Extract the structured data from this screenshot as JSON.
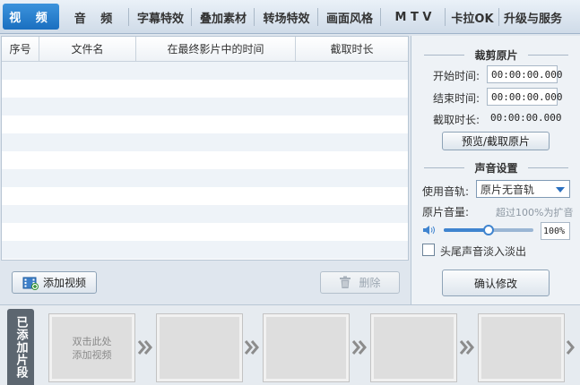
{
  "tabs": [
    {
      "label": "视 频",
      "active": true
    },
    {
      "label": "音 频"
    },
    {
      "label": "字幕特效"
    },
    {
      "label": "叠加素材"
    },
    {
      "label": "转场特效"
    },
    {
      "label": "画面风格"
    },
    {
      "label": "M T V"
    },
    {
      "label": "卡拉OK"
    },
    {
      "label": "升级与服务"
    }
  ],
  "table": {
    "columns": [
      "序号",
      "文件名",
      "在最终影片中的时间",
      "截取时长"
    ],
    "rows": []
  },
  "buttons": {
    "add_video": "添加视频",
    "delete": "删除",
    "preview_trim": "预览/截取原片",
    "confirm": "确认修改"
  },
  "trim": {
    "title": "裁剪原片",
    "start_label": "开始时间:",
    "start_value": "00:00:00.000",
    "end_label": "结束时间:",
    "end_value": "00:00:00.000",
    "duration_label": "截取时长:",
    "duration_value": "00:00:00.000"
  },
  "audio": {
    "title": "声音设置",
    "track_label": "使用音轨:",
    "track_value": "原片无音轨",
    "volume_label": "原片音量:",
    "volume_hint": "超过100%为扩音",
    "volume_value": "100%",
    "volume_level": 0.5,
    "fade_label": "头尾声音淡入淡出"
  },
  "clips": {
    "label": "已添加片段",
    "first_slot_text_line1": "双击此处",
    "first_slot_text_line2": "添加视频"
  },
  "colors": {
    "active_tab": "#1a6fc0",
    "accent": "#3f84cf"
  }
}
